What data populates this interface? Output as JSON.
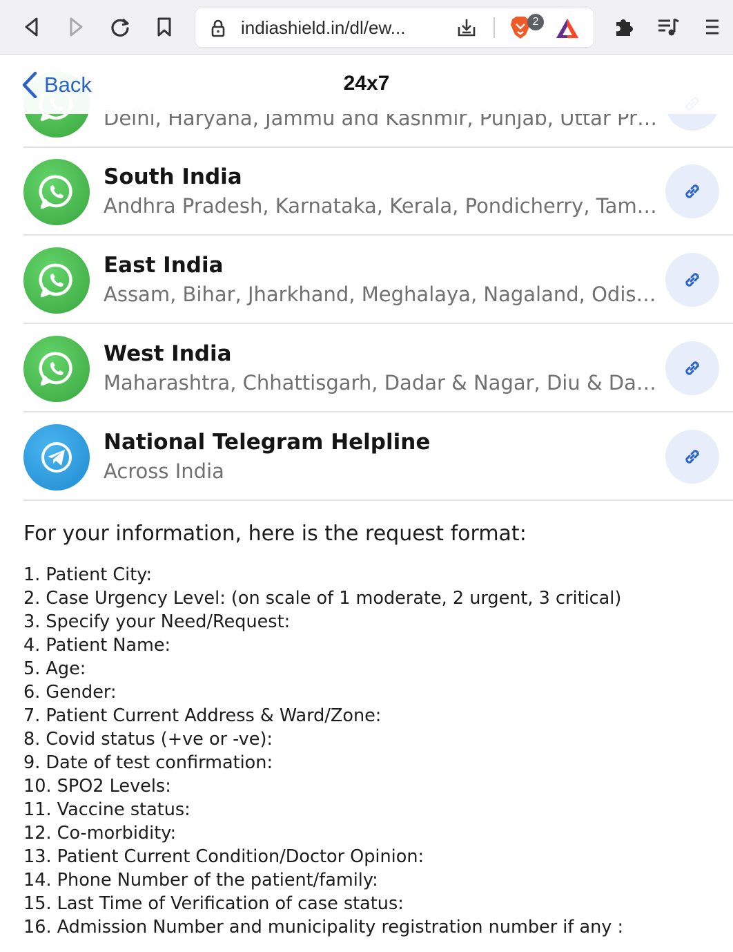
{
  "browser": {
    "url": "indiashield.in/dl/ew...",
    "shields_count": "2"
  },
  "header": {
    "back_label": "Back",
    "title": "24x7"
  },
  "rows": [
    {
      "title": "",
      "subtitle": "Delhi, Haryana, Jammu and Kashmir, Punjab, Uttar Pra...",
      "icon": "whatsapp-icon"
    },
    {
      "title": "South India",
      "subtitle": "Andhra Pradesh, Karnataka, Kerala, Pondicherry, Tamil ...",
      "icon": "whatsapp-icon"
    },
    {
      "title": "East India",
      "subtitle": "Assam, Bihar, Jharkhand, Meghalaya, Nagaland, Odish...",
      "icon": "whatsapp-icon"
    },
    {
      "title": "West India",
      "subtitle": "Maharashtra, Chhattisgarh, Dadar & Nagar, Diu & Dam...",
      "icon": "whatsapp-icon"
    },
    {
      "title": "National Telegram Helpline",
      "subtitle": "Across India",
      "icon": "telegram-icon"
    }
  ],
  "info": {
    "intro": "For your information, here is the request format:",
    "items": [
      "1. Patient City:",
      "2. Case Urgency Level: (on scale of 1 moderate, 2 urgent, 3 critical)",
      "3. Specify your Need/Request:",
      "4. Patient Name:",
      "5. Age:",
      "6. Gender:",
      "7. Patient Current Address & Ward/Zone:",
      "8. Covid status (+ve or -ve):",
      "9. Date of test confirmation:",
      "10. SPO2 Levels:",
      "11. Vaccine status:",
      "12. Co-morbidity:",
      "13. Patient Current Condition/Doctor Opinion:",
      "14. Phone Number of the patient/family:",
      "15. Last Time of Verification of case status:",
      "16. Admission Number and municipality registration number if any :"
    ]
  },
  "colors": {
    "accent": "#2a62c9",
    "whatsapp": "#3aa63f",
    "telegram": "#1f8bd3",
    "link_bg": "#e7eef9"
  }
}
